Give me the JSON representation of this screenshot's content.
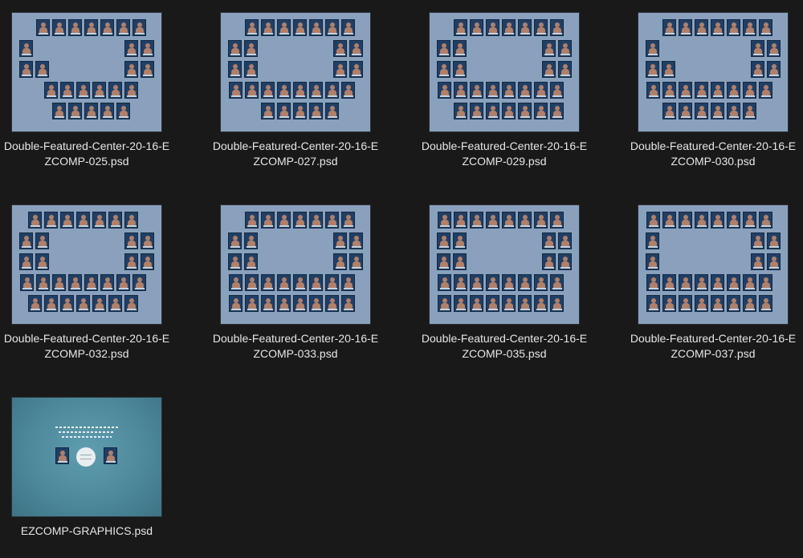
{
  "files": [
    {
      "name": "Double-Featured-Center-20-16-EZCOMP-025.psd",
      "kind": "composite"
    },
    {
      "name": "Double-Featured-Center-20-16-EZCOMP-027.psd",
      "kind": "composite"
    },
    {
      "name": "Double-Featured-Center-20-16-EZCOMP-029.psd",
      "kind": "composite"
    },
    {
      "name": "Double-Featured-Center-20-16-EZCOMP-030.psd",
      "kind": "composite"
    },
    {
      "name": "Double-Featured-Center-20-16-EZCOMP-032.psd",
      "kind": "composite"
    },
    {
      "name": "Double-Featured-Center-20-16-EZCOMP-033.psd",
      "kind": "composite"
    },
    {
      "name": "Double-Featured-Center-20-16-EZCOMP-035.psd",
      "kind": "composite"
    },
    {
      "name": "Double-Featured-Center-20-16-EZCOMP-037.psd",
      "kind": "composite"
    },
    {
      "name": "EZCOMP-GRAPHICS.psd",
      "kind": "graphics"
    }
  ],
  "colors": {
    "background": "#191919",
    "composite_thumb": "#8aa1bd",
    "graphics_thumb": "#4a8799",
    "portrait_frame": "#1f3f66",
    "label_text": "#e6e6e6"
  }
}
